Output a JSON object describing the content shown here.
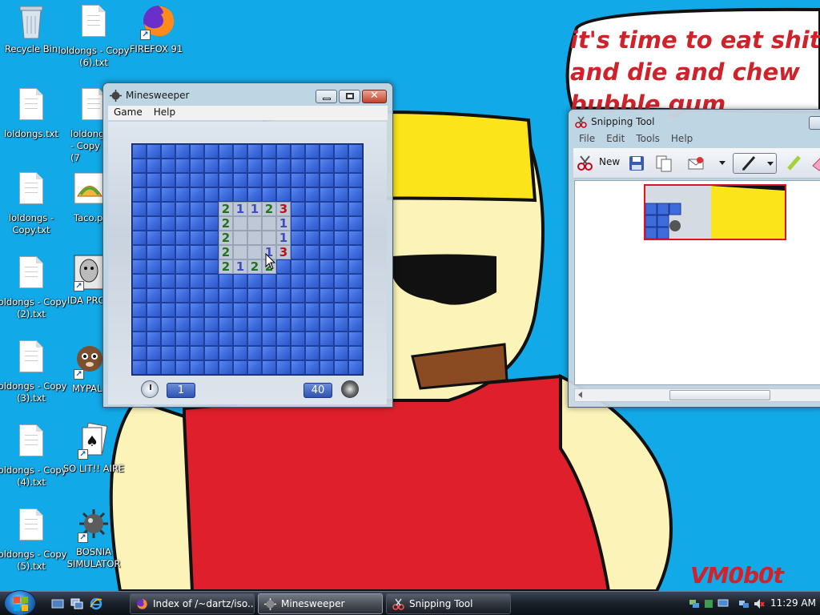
{
  "wallpaper": {
    "speech_lines": [
      "it's time to eat shit",
      "and die and chew",
      "bubble gum"
    ],
    "signature": "VM0b0t"
  },
  "desktop_icons": [
    {
      "label": "Recycle Bin",
      "icon": "recycle-bin-icon"
    },
    {
      "label": "loldongs - Copy (6).txt",
      "icon": "text-file-icon"
    },
    {
      "label": "FIREFOX 91",
      "icon": "firefox-icon"
    },
    {
      "label": "loldongs.txt",
      "icon": "text-file-icon"
    },
    {
      "label": "loldongs - Copy (7",
      "icon": "text-file-icon"
    },
    {
      "label": "loldongs - Copy.txt",
      "icon": "text-file-icon"
    },
    {
      "label": "Taco.p",
      "icon": "taco-image-icon"
    },
    {
      "label": "loldongs - Copy (2).txt",
      "icon": "text-file-icon"
    },
    {
      "label": "IDA PRO",
      "icon": "ida-pro-icon"
    },
    {
      "label": "loldongs - Copy (3).txt",
      "icon": "text-file-icon"
    },
    {
      "label": "MYPAL",
      "icon": "mypal-icon"
    },
    {
      "label": "loldongs - Copy (4).txt",
      "icon": "text-file-icon"
    },
    {
      "label": "SO LIT!! AIRE",
      "icon": "solitaire-icon"
    },
    {
      "label": "loldongs - Copy (5).txt",
      "icon": "text-file-icon"
    },
    {
      "label": "BOSNIA SIMULATOR",
      "icon": "mine-icon"
    }
  ],
  "minesweeper": {
    "title": "Minesweeper",
    "menu": [
      "Game",
      "Help"
    ],
    "timer": "1",
    "mines_left": "40",
    "board_size": 16,
    "revealed": [
      {
        "r": 4,
        "c": 6,
        "v": "2"
      },
      {
        "r": 4,
        "c": 7,
        "v": "1"
      },
      {
        "r": 4,
        "c": 8,
        "v": "1"
      },
      {
        "r": 4,
        "c": 9,
        "v": "2"
      },
      {
        "r": 4,
        "c": 10,
        "v": "3"
      },
      {
        "r": 5,
        "c": 6,
        "v": "2"
      },
      {
        "r": 5,
        "c": 7,
        "v": ""
      },
      {
        "r": 5,
        "c": 8,
        "v": ""
      },
      {
        "r": 5,
        "c": 9,
        "v": ""
      },
      {
        "r": 5,
        "c": 10,
        "v": "1"
      },
      {
        "r": 6,
        "c": 6,
        "v": "2"
      },
      {
        "r": 6,
        "c": 7,
        "v": ""
      },
      {
        "r": 6,
        "c": 8,
        "v": ""
      },
      {
        "r": 6,
        "c": 9,
        "v": ""
      },
      {
        "r": 6,
        "c": 10,
        "v": "1"
      },
      {
        "r": 7,
        "c": 6,
        "v": "2"
      },
      {
        "r": 7,
        "c": 7,
        "v": ""
      },
      {
        "r": 7,
        "c": 8,
        "v": ""
      },
      {
        "r": 7,
        "c": 9,
        "v": "1"
      },
      {
        "r": 7,
        "c": 10,
        "v": "3"
      },
      {
        "r": 8,
        "c": 6,
        "v": "2"
      },
      {
        "r": 8,
        "c": 7,
        "v": "1"
      },
      {
        "r": 8,
        "c": 8,
        "v": "2"
      },
      {
        "r": 8,
        "c": 9,
        "v": "2"
      }
    ]
  },
  "snipping_tool": {
    "title": "Snipping Tool",
    "menu": [
      "File",
      "Edit",
      "Tools",
      "Help"
    ],
    "new_label": "New"
  },
  "taskbar": {
    "tasks": [
      {
        "label": "Index of /~dartz/iso...",
        "icon": "firefox-icon"
      },
      {
        "label": "Minesweeper",
        "icon": "minesweeper-icon"
      },
      {
        "label": "Snipping Tool",
        "icon": "snipping-tool-icon"
      }
    ],
    "clock": "11:29 AM"
  }
}
